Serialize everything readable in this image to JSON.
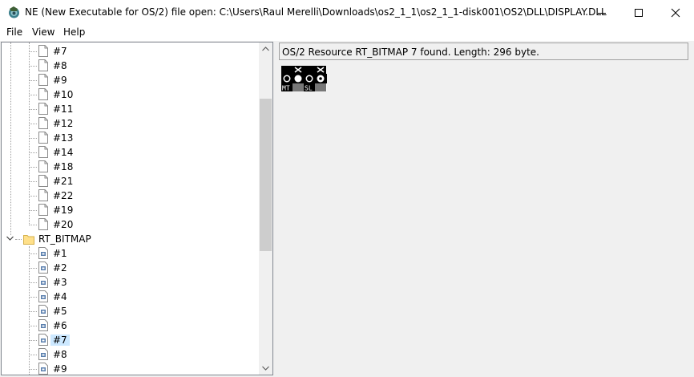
{
  "window": {
    "title": "NE (New Executable for OS/2) file open: C:\\Users\\Raul Merelli\\Downloads\\os2_1_1\\os2_1_1-disk001\\OS2\\DLL\\DISPLAY.DLL",
    "minimize_icon": "minimize-icon",
    "maximize_icon": "maximize-icon",
    "close_icon": "close-icon"
  },
  "menu": {
    "items": [
      "File",
      "View",
      "Help"
    ]
  },
  "tree": {
    "upper_items": [
      "#7",
      "#8",
      "#9",
      "#10",
      "#11",
      "#12",
      "#13",
      "#14",
      "#18",
      "#21",
      "#22",
      "#19",
      "#20"
    ],
    "folder_label": "RT_BITMAP",
    "bitmap_items": [
      "#1",
      "#2",
      "#3",
      "#4",
      "#5",
      "#6",
      "#7",
      "#8",
      "#9"
    ],
    "selected_item": "#7"
  },
  "detail": {
    "status": "OS/2 Resource RT_BITMAP 7 found. Length: 296 byte.",
    "bitmap_labels": [
      "MT",
      "SL"
    ]
  }
}
